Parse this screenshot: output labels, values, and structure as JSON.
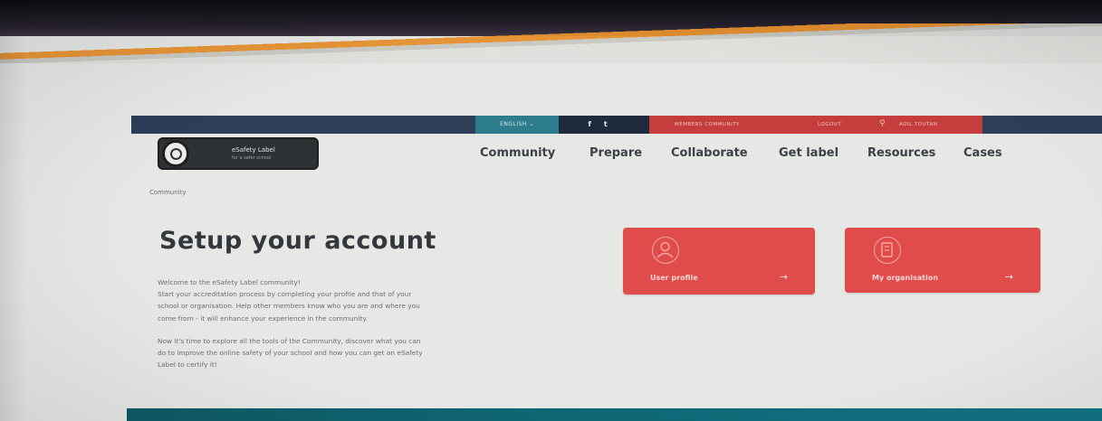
{
  "topbar": {
    "language": "ENGLISH",
    "social": [
      "f",
      "t"
    ],
    "members": "MEMBERS COMMUNITY",
    "logout": "LOGOUT",
    "user": "ADIL TOUTAN"
  },
  "logo": {
    "title": "eSafety Label",
    "subtitle": "for a safer school"
  },
  "nav": {
    "items": [
      "Community",
      "Prepare",
      "Collaborate",
      "Get label",
      "Resources",
      "Cases"
    ]
  },
  "breadcrumb": "Community",
  "page": {
    "title": "Setup your account",
    "intro": [
      "Welcome to the eSafety Label community!",
      "Start your accreditation process by completing your profile and that of your",
      "school or organisation. Help other members know who you are and where you",
      "come from - it will enhance your experience in the community."
    ],
    "outro": [
      "Now it's time to explore all the tools of the Community, discover what you can",
      "do to improve the online safety of your school and how you can get an eSafety",
      "Label to certify it!"
    ]
  },
  "cards": [
    {
      "label": "User profile",
      "arrow": "→",
      "icon": "user-icon"
    },
    {
      "label": "My organisation",
      "arrow": "→",
      "icon": "organisation-icon"
    }
  ],
  "colors": {
    "topbar": "#2c3e58",
    "accent_red": "#e04c4c",
    "teal": "#2e7d8c"
  }
}
